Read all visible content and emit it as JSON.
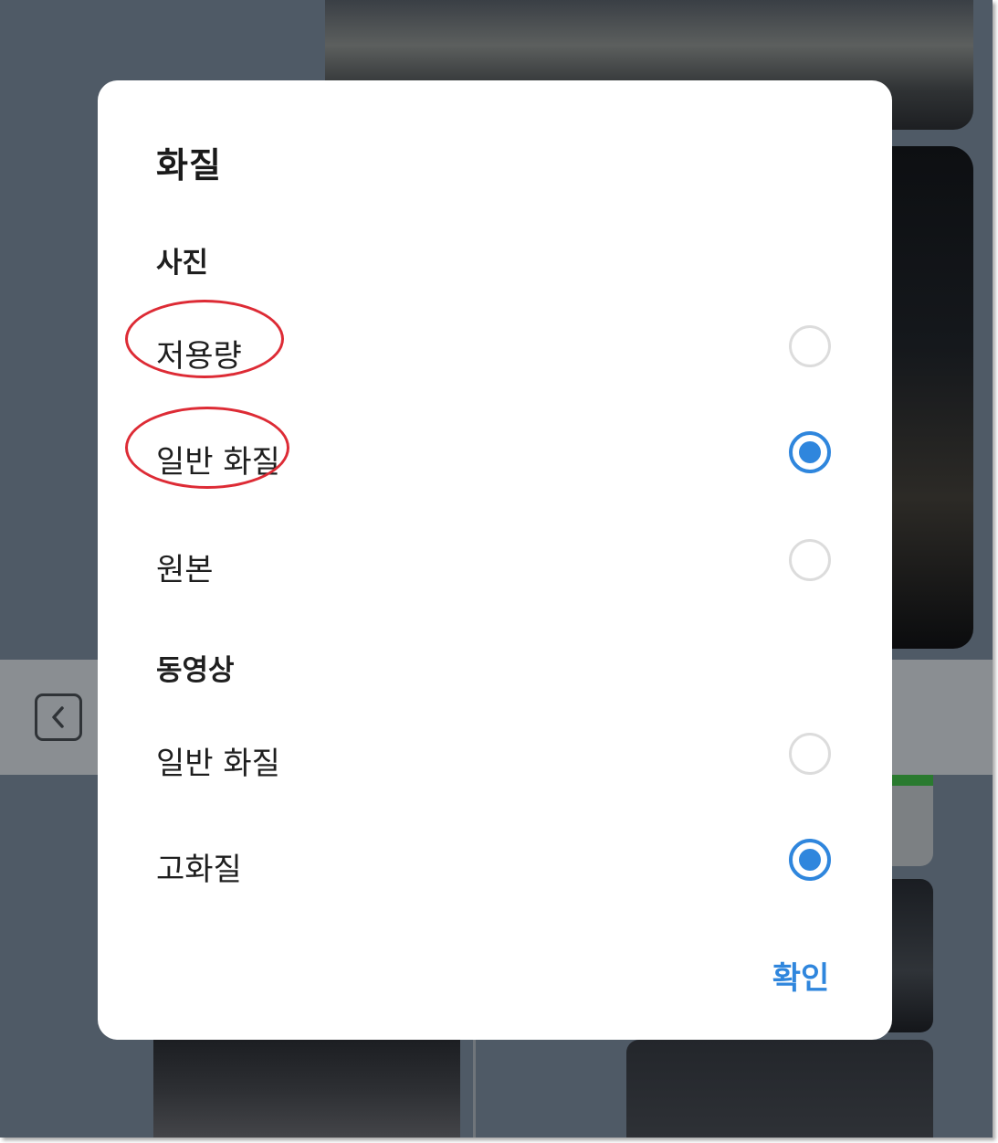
{
  "dialog": {
    "title": "화질",
    "sections": [
      {
        "title": "사진",
        "options": [
          {
            "label": "저용량",
            "selected": false
          },
          {
            "label": "일반 화질",
            "selected": true
          },
          {
            "label": "원본",
            "selected": false
          }
        ]
      },
      {
        "title": "동영상",
        "options": [
          {
            "label": "일반 화질",
            "selected": false
          },
          {
            "label": "고화질",
            "selected": true
          }
        ]
      }
    ],
    "confirm_label": "확인"
  },
  "colors": {
    "accent": "#2f86dd",
    "annotation": "#dd2b35",
    "backdrop": "#4f5a66"
  },
  "background": {
    "back_icon": "chevron-left-icon"
  }
}
